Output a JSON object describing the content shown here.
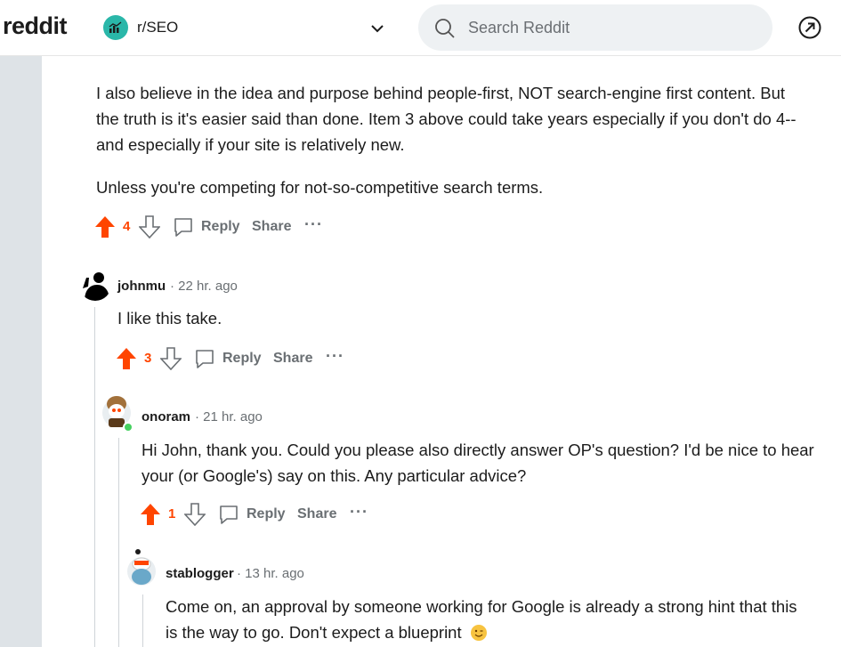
{
  "header": {
    "logo": "reddit",
    "subreddit": "r/SEO",
    "search_placeholder": "Search Reddit"
  },
  "comments": [
    {
      "paragraphs": [
        "I also believe in the idea and purpose behind people-first, NOT search-engine first content. But",
        "the truth is it's easier said than done. Item 3 above could take years especially if you don't do 4--",
        "and especially if your site is relatively new.",
        "Unless you're competing for not-so-competitive search terms."
      ],
      "votes": "4"
    },
    {
      "user": "johnmu",
      "time": "· 22 hr. ago",
      "text": "I like this take.",
      "votes": "3"
    },
    {
      "user": "onoram",
      "time": "· 21 hr. ago",
      "lines": [
        "Hi John, thank you. Could you please also directly answer OP's question? I'd be nice to hear",
        "your (or Google's) say on this. Any particular advice?"
      ],
      "votes": "1"
    },
    {
      "user": "stablogger",
      "time": "· 13 hr. ago",
      "lines": [
        "Come on, an approval by someone working for Google is already a strong hint that this",
        "is the way to go. Don't expect a blueprint"
      ]
    }
  ],
  "actions": {
    "reply": "Reply",
    "share": "Share",
    "more": "···"
  },
  "colors": {
    "upvote": "#ff4500",
    "muted": "#6a6f73",
    "rail": "#dee3e7"
  }
}
